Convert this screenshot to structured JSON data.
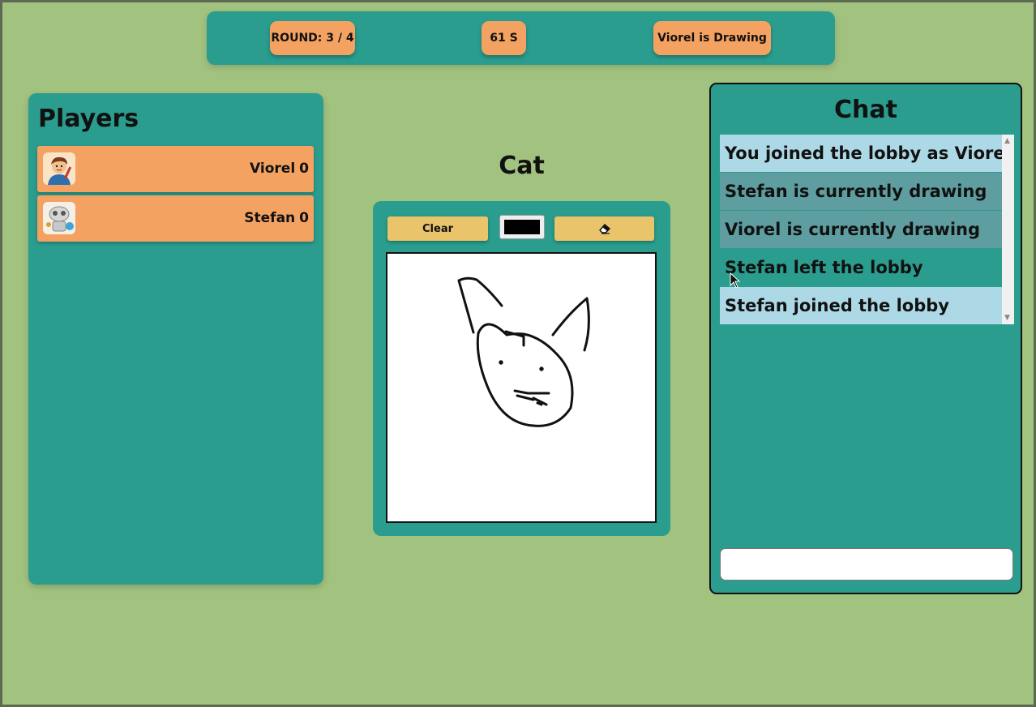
{
  "header": {
    "round": "ROUND: 3 / 4",
    "timer": "61 S",
    "drawer_status": "Viorel is Drawing"
  },
  "players_panel": {
    "title": "Players",
    "players": [
      {
        "name": "Viorel",
        "score": "0",
        "avatar": "boy-painter-avatar-icon"
      },
      {
        "name": "Stefan",
        "score": "0",
        "avatar": "robot-painter-avatar-icon"
      }
    ]
  },
  "word": "Cat",
  "toolbar": {
    "clear_label": "Clear",
    "eraser_icon": "eraser-icon",
    "selected_color": "#000000"
  },
  "chat": {
    "title": "Chat",
    "messages": [
      {
        "who": "",
        "text": "You joined the lobby as Viorel",
        "style": "light"
      },
      {
        "who": "Stefan",
        "text": "is currently drawing",
        "style": "dark"
      },
      {
        "who": "Viorel",
        "text": "is currently drawing",
        "style": "dark"
      },
      {
        "who": "Stefan",
        "text": "left the lobby",
        "style": "none"
      },
      {
        "who": "Stefan",
        "text": "joined the lobby",
        "style": "light"
      }
    ],
    "input_value": "",
    "input_placeholder": ""
  },
  "colors": {
    "background": "#a2c280",
    "panel": "#2a9d8f",
    "pill": "#f4a261",
    "button": "#e9c46a"
  }
}
